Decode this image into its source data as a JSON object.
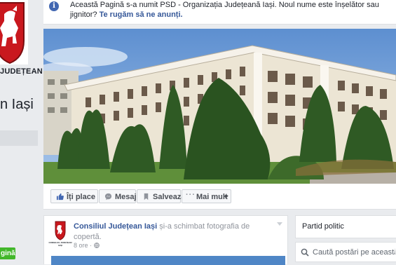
{
  "notice": {
    "message": "Această Pagină s-a numit PSD - Organizația Județeană Iași. Noul nume este înșelător sau jignitor?",
    "link_label": "Te rugăm să ne anunți."
  },
  "page": {
    "brand_text": "JUDEȚEAN",
    "name_fragment": "n Iași",
    "badge_fragment": "gină"
  },
  "actions": {
    "like": "Îți place",
    "message": "Mesaj",
    "save": "Salvează",
    "more": "Mai mult"
  },
  "post": {
    "author": "Consiliul Județean Iași",
    "action": "și-a schimbat fotografia de copertă.",
    "time": "8 ore",
    "avatar_caption": "CONSILIUL JUDEȚEAN IAȘI"
  },
  "sidebar": {
    "category": "Partid politic",
    "search_placeholder": "Caută postări pe această Pagină"
  },
  "colors": {
    "background": "#e9ebee",
    "link": "#365899",
    "accent": "#4267b2",
    "badge": "#42b72a"
  },
  "icons": [
    "info-icon",
    "like-icon",
    "message-icon",
    "bookmark-icon",
    "chevron-down-icon",
    "globe-icon",
    "search-icon",
    "coat-of-arms-icon"
  ]
}
